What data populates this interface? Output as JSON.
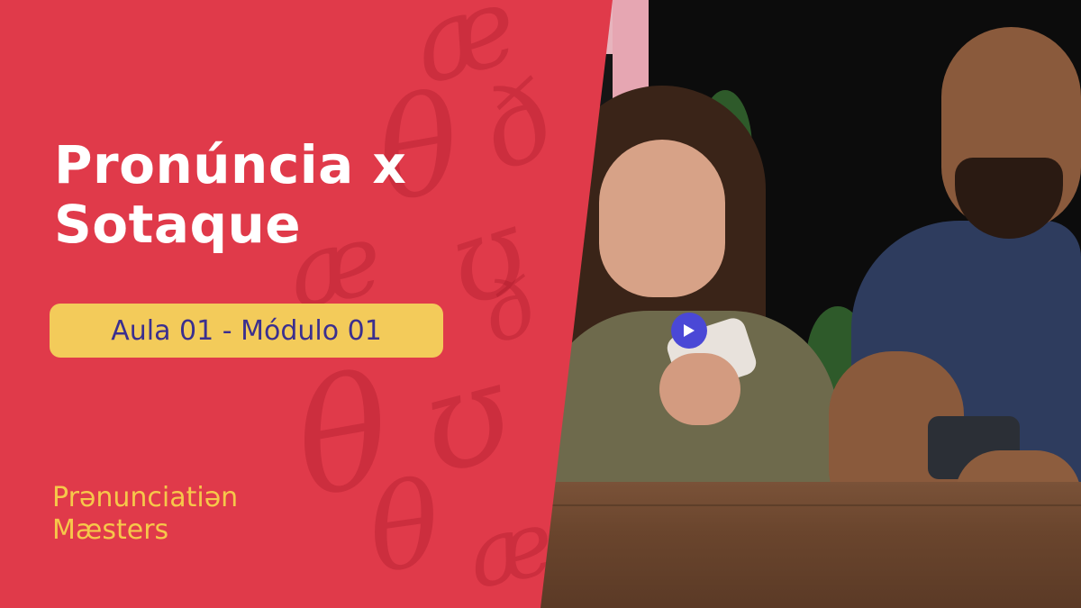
{
  "title_line1": "Pronúncia x",
  "title_line2": "Sotaque",
  "lesson_badge": "Aula 01 - Módulo 01",
  "brand": {
    "line1": "Prənunciatiən",
    "line2": "Mæsters"
  },
  "background_glyphs": [
    "æ",
    "θ",
    "ð",
    "ʊ",
    "æ",
    "θ",
    "ʊ",
    "θ",
    "ð",
    "æ"
  ],
  "colors": {
    "panel_red": "#e03a4a",
    "badge_yellow": "#f3cb5a",
    "badge_text": "#3b2f8f",
    "title_text": "#ffffff",
    "brand_text": "#f6c84a",
    "play_button": "#4a48d6"
  },
  "icons": {
    "play": "play-icon"
  }
}
